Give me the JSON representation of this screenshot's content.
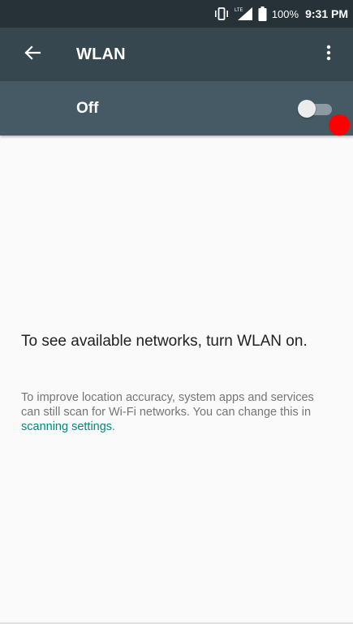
{
  "status_bar": {
    "icons": [
      "vibrate-icon",
      "lte-signal-icon",
      "battery-icon"
    ],
    "network_label": "LTE",
    "battery_percent": "100%",
    "time": "9:31 PM"
  },
  "app_bar": {
    "back_icon": "arrow-left-icon",
    "title": "WLAN",
    "overflow_icon": "more-vertical-icon"
  },
  "switch_bar": {
    "label": "Off",
    "checked": false,
    "colors": {
      "background": "#455a64",
      "track_off": "#8d9aa1",
      "thumb_off": "#ececec"
    }
  },
  "content": {
    "empty_message": "To see available networks, turn WLAN on.",
    "scan_note_prefix": "To improve location accuracy, system apps and services can still scan for Wi-Fi networks. You can change this in ",
    "scan_note_link": "scanning settings",
    "scan_note_suffix": "."
  },
  "touch_indicator": {
    "color": "#ff0000"
  },
  "colors": {
    "status_bar": "#263238",
    "app_bar": "#37474f",
    "switch_bar": "#455a64",
    "background": "#fafafa",
    "link": "#00897b"
  }
}
